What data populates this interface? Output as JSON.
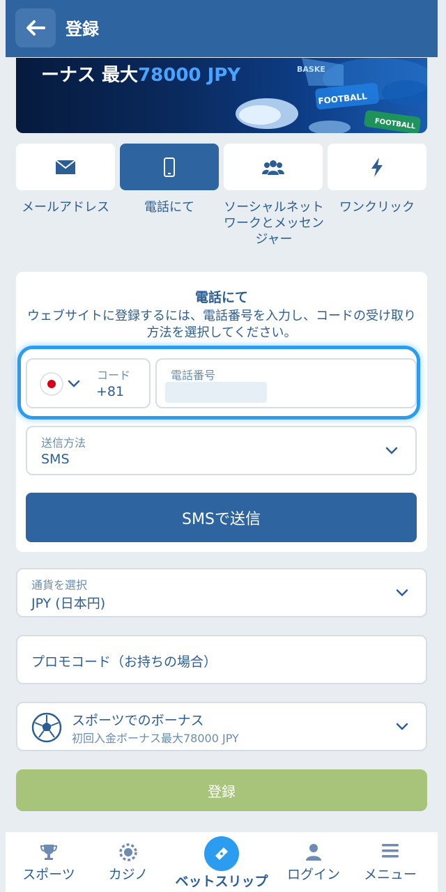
{
  "header": {
    "title": "登録"
  },
  "banner": {
    "text_prefix": "ーナス 最大",
    "text_accent": "78000 JPY",
    "ball_labels": [
      "BASKE",
      "FOOTBALL",
      "FOOTBALL"
    ]
  },
  "methods": [
    {
      "label": "メールアドレス",
      "icon": "envelope-icon",
      "active": false
    },
    {
      "label": "電話にて",
      "icon": "phone-icon",
      "active": true
    },
    {
      "label": "ソーシャルネットワークとメッセンジャー",
      "icon": "people-icon",
      "active": false
    },
    {
      "label": "ワンクリック",
      "icon": "lightning-icon",
      "active": false
    }
  ],
  "phone_card": {
    "title": "電話にて",
    "description": "ウェブサイトに登録するには、電話番号を入力し、コードの受け取り方法を選択してください。",
    "code_label": "コード",
    "code_value": "+81",
    "phone_label": "電話番号",
    "send_method_label": "送信方法",
    "send_method_value": "SMS",
    "send_button": "SMSで送信"
  },
  "currency": {
    "label": "通貨を選択",
    "value": "JPY (日本円)"
  },
  "promo": {
    "placeholder": "プロモコード（お持ちの場合）"
  },
  "bonus": {
    "title": "スポーツでのボーナス",
    "subtitle": "初回入金ボーナス最大78000 JPY"
  },
  "register_button": "登録",
  "nav": {
    "sports": "スポーツ",
    "casino": "カジノ",
    "betslip": "ベットスリップ",
    "login": "ログイン",
    "menu": "メニュー"
  },
  "colors": {
    "primary": "#2e64a0",
    "accent_blue": "#2b9cf0",
    "register_green": "#a8c47a",
    "background": "#e8edf2"
  }
}
